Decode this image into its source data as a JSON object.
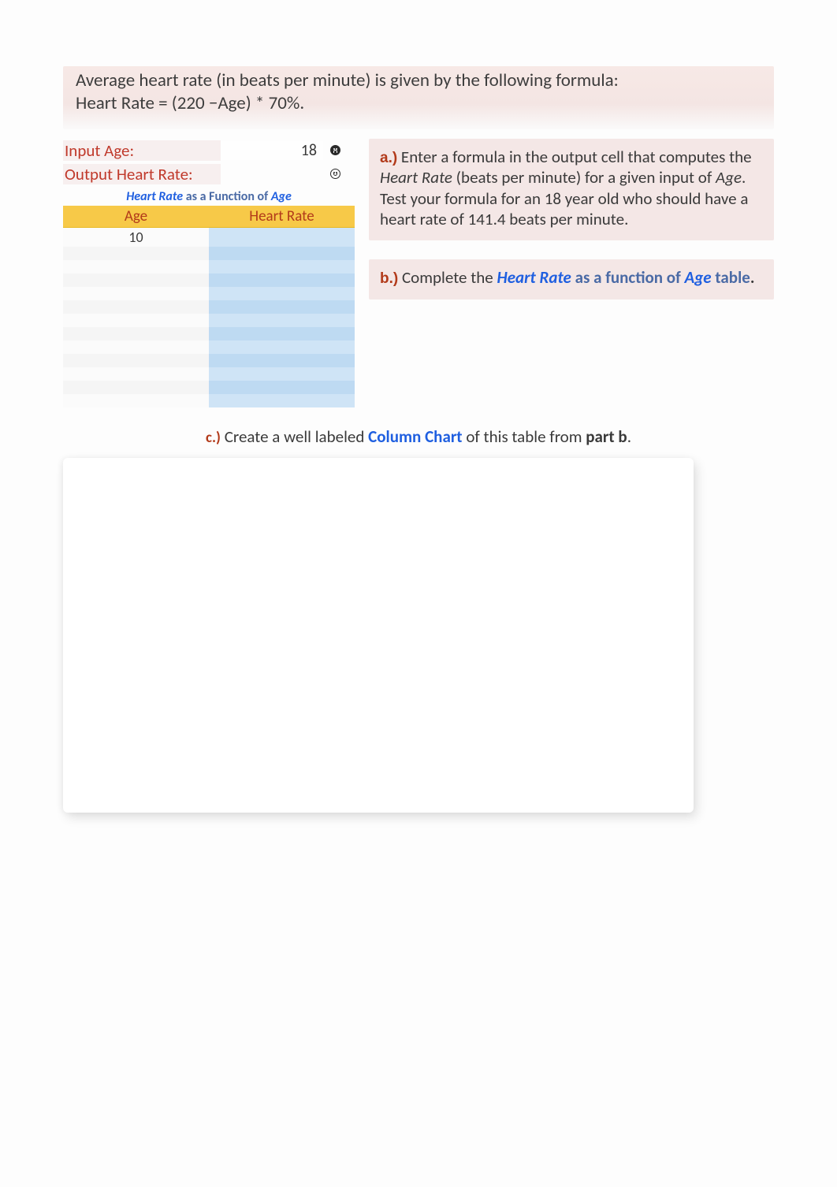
{
  "intro": {
    "line1": "Average heart rate (in beats per minute) is given by the following formula:",
    "line2": "Heart Rate = (220 −Age)  *  70%."
  },
  "io": {
    "input_label": "Input Age:",
    "input_value": "18",
    "output_label": "Output Heart Rate:",
    "output_value": ""
  },
  "icons": {
    "input_status": "frown-face-icon",
    "output_status": "smile-face-icon"
  },
  "table": {
    "title_part1": "Heart Rate",
    "title_part2": " as a Function of ",
    "title_part3": "Age",
    "headers": {
      "age": "Age",
      "hr": "Heart Rate"
    },
    "rows": [
      {
        "age": "10",
        "hr": ""
      },
      {
        "age": "",
        "hr": ""
      },
      {
        "age": "",
        "hr": ""
      },
      {
        "age": "",
        "hr": ""
      },
      {
        "age": "",
        "hr": ""
      },
      {
        "age": "",
        "hr": ""
      },
      {
        "age": "",
        "hr": ""
      },
      {
        "age": "",
        "hr": ""
      },
      {
        "age": "",
        "hr": ""
      },
      {
        "age": "",
        "hr": ""
      },
      {
        "age": "",
        "hr": ""
      },
      {
        "age": "",
        "hr": ""
      },
      {
        "age": "",
        "hr": ""
      }
    ]
  },
  "instructions": {
    "a": {
      "label": "a.)",
      "text_pre": "  Enter a formula in the output cell that computes the ",
      "hr_term": "Heart Rate",
      "text_mid": " (beats per minute) for a given input of ",
      "age_term": "Age",
      "text_post": ".  Test your formula for an 18 year old who should have a heart rate of 141.4 beats per minute."
    },
    "b": {
      "label": "b.)",
      "text_pre": "  Complete the ",
      "hr_term": "Heart Rate",
      "func_text": " as a function of ",
      "age_term": "Age",
      "text_post": " table",
      "period": "."
    },
    "c": {
      "label": "c.)",
      "text_pre": "  Create a well labeled ",
      "chart_term": "Column Chart",
      "text_mid": " of this table from ",
      "partb_term": "part b",
      "period": "."
    }
  }
}
